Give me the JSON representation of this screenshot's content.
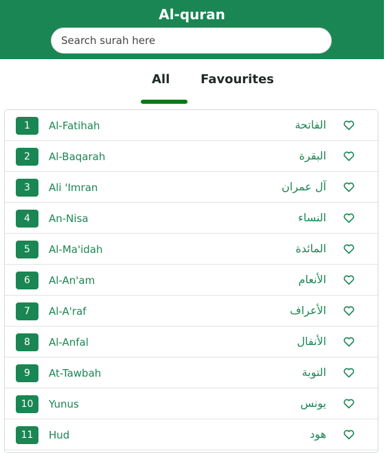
{
  "header": {
    "title": "Al-quran",
    "search_placeholder": "Search surah here"
  },
  "tabs": {
    "all": "All",
    "favourites": "Favourites",
    "active": "All"
  },
  "colors": {
    "primary": "#1a8653",
    "indicator": "#0a7a16"
  },
  "surahs": [
    {
      "number": "1",
      "name": "Al-Fatihah",
      "arabic": "الفاتحة",
      "icon": "heart-outline-icon"
    },
    {
      "number": "2",
      "name": "Al-Baqarah",
      "arabic": "البقرة",
      "icon": "heart-outline-icon"
    },
    {
      "number": "3",
      "name": "Ali 'Imran",
      "arabic": "آل عمران",
      "icon": "heart-outline-icon"
    },
    {
      "number": "4",
      "name": "An-Nisa",
      "arabic": "النساء",
      "icon": "heart-outline-icon"
    },
    {
      "number": "5",
      "name": "Al-Ma'idah",
      "arabic": "المائدة",
      "icon": "heart-outline-icon"
    },
    {
      "number": "6",
      "name": "Al-An'am",
      "arabic": "الأنعام",
      "icon": "heart-outline-icon"
    },
    {
      "number": "7",
      "name": "Al-A'raf",
      "arabic": "الأعراف",
      "icon": "heart-outline-icon"
    },
    {
      "number": "8",
      "name": "Al-Anfal",
      "arabic": "الأنفال",
      "icon": "heart-outline-icon"
    },
    {
      "number": "9",
      "name": "At-Tawbah",
      "arabic": "التوبة",
      "icon": "heart-outline-icon"
    },
    {
      "number": "10",
      "name": "Yunus",
      "arabic": "يونس",
      "icon": "heart-outline-icon"
    },
    {
      "number": "11",
      "name": "Hud",
      "arabic": "هود",
      "icon": "heart-outline-icon"
    }
  ]
}
